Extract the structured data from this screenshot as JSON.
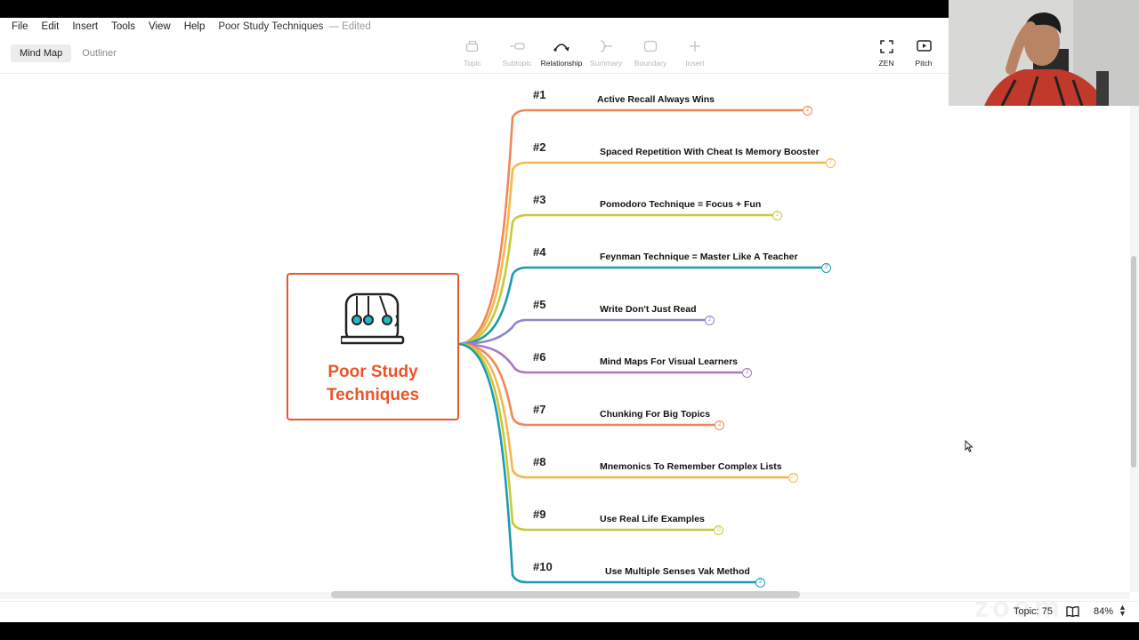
{
  "menu": [
    "File",
    "Edit",
    "Insert",
    "Tools",
    "View",
    "Help"
  ],
  "document": {
    "title": "Poor Study Techniques",
    "status": "— Edited"
  },
  "view_tabs": {
    "mindmap": "Mind Map",
    "outliner": "Outliner"
  },
  "toolbar": {
    "topic": "Topic",
    "subtopic": "Subtopic",
    "relationship": "Relationship",
    "summary": "Summary",
    "boundary": "Boundary",
    "insert": "Insert",
    "zen": "ZEN",
    "pitch": "Pitch"
  },
  "central_topic": {
    "line1": "Poor Study",
    "line2": "Techniques",
    "color": "#e8562a"
  },
  "branches": [
    {
      "num": "#1",
      "label": "Active Recall Always Wins",
      "badge": "2",
      "color": "#ef8858"
    },
    {
      "num": "#2",
      "label": "Spaced Repetition With Cheat Is Memory Booster",
      "badge": "7",
      "color": "#f6b74f"
    },
    {
      "num": "#3",
      "label": "Pomodoro Technique = Focus + Fun",
      "badge": "2",
      "color": "#c7c93b"
    },
    {
      "num": "#4",
      "label": "Feynman Technique = Master Like A Teacher",
      "badge": "2",
      "color": "#1a9bb0"
    },
    {
      "num": "#5",
      "label": "Write Don't Just Read",
      "badge": "2",
      "color": "#8a87c9"
    },
    {
      "num": "#6",
      "label": "Mind Maps For Visual Learners",
      "badge": "2",
      "color": "#a87abf"
    },
    {
      "num": "#7",
      "label": "Chunking For Big Topics",
      "badge": "2",
      "color": "#ef8858"
    },
    {
      "num": "#8",
      "label": "Mnemonics To Remember Complex Lists",
      "badge": "27",
      "color": "#f6b74f"
    },
    {
      "num": "#9",
      "label": "Use Real Life Examples",
      "badge": "11",
      "color": "#c7c93b"
    },
    {
      "num": "#10",
      "label": "Use Multiple Senses Vak Method",
      "badge": "2",
      "color": "#1a9bb0"
    }
  ],
  "status": {
    "topic_count": "Topic: 75",
    "zoom": "84%"
  },
  "watermark": "zoom"
}
